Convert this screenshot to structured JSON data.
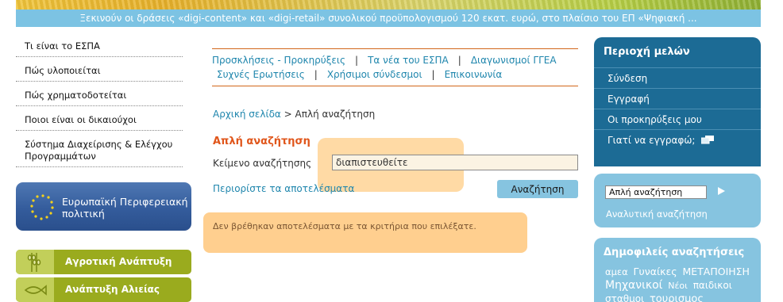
{
  "ticker": "Ξεκινούν οι δράσεις «digi-content» και «digi-retail» συνολικού προϋπολογισμού 120 εκατ. ευρώ, στο πλαίσιο του ΕΠ «Ψηφιακή ...",
  "left_menu": [
    "Τι είναι το ΕΣΠΑ",
    "Πώς υλοποιείται",
    "Πώς χρηματοδοτείται",
    "Ποιοι είναι οι δικαιούχοι",
    "Σύστημα Διαχείρισης & Ελέγχου",
    "Προγραμμάτων"
  ],
  "eu_box": {
    "line1": "Ευρωπαϊκή Περιφερειακή",
    "line2": "πολιτική"
  },
  "green_boxes": [
    "Αγροτική Ανάπτυξη",
    "Ανάπτυξη Αλιείας"
  ],
  "top_nav": {
    "row1": [
      "Προσκλήσεις - Προκηρύξεις",
      "Τα νέα του ΕΣΠΑ",
      "Διαγωνισμοί ΓΓΕΑ"
    ],
    "row2": [
      "Συχνές Ερωτήσεις",
      "Χρήσιμοι σύνδεσμοι",
      "Επικοινωνία"
    ],
    "separator": "|"
  },
  "breadcrumb": {
    "home": "Αρχική σελίδα",
    "sep": ">",
    "current": "Απλή αναζήτηση"
  },
  "search": {
    "title": "Απλή αναζήτηση",
    "label": "Κείμενο αναζήτησης",
    "value": "διαπιστευθείτε",
    "refine": "Περιορίστε τα αποτελέσματα",
    "button": "Αναζήτηση",
    "no_results": "Δεν βρέθηκαν αποτελέσματα με τα κριτήρια που επιλέξατε."
  },
  "members": {
    "title": "Περιοχή μελών",
    "items": [
      "Σύνδεση",
      "Εγγραφή",
      "Οι προκηρύξεις μου",
      "Γιατί να εγγραφώ;"
    ]
  },
  "quick_search": {
    "value": "Απλή αναζήτηση",
    "advanced": "Αναλυτική αναζήτηση"
  },
  "popular": {
    "title": "Δημοφιλείς αναζητήσεις",
    "tags": [
      "αμεα",
      "Γυναίκες",
      "ΜΕΤΑΠΟΙΗΣΗ",
      "Μηχανικοί",
      "Νέοι",
      "παιδικοι",
      "σταθμοι",
      "τουρισμος"
    ]
  },
  "colors": {
    "accent_blue": "#1f86ad",
    "members_blue": "#1c6b95",
    "light_blue": "#86c4e0",
    "orange": "#e0561b",
    "olive": "#9aab1e"
  }
}
